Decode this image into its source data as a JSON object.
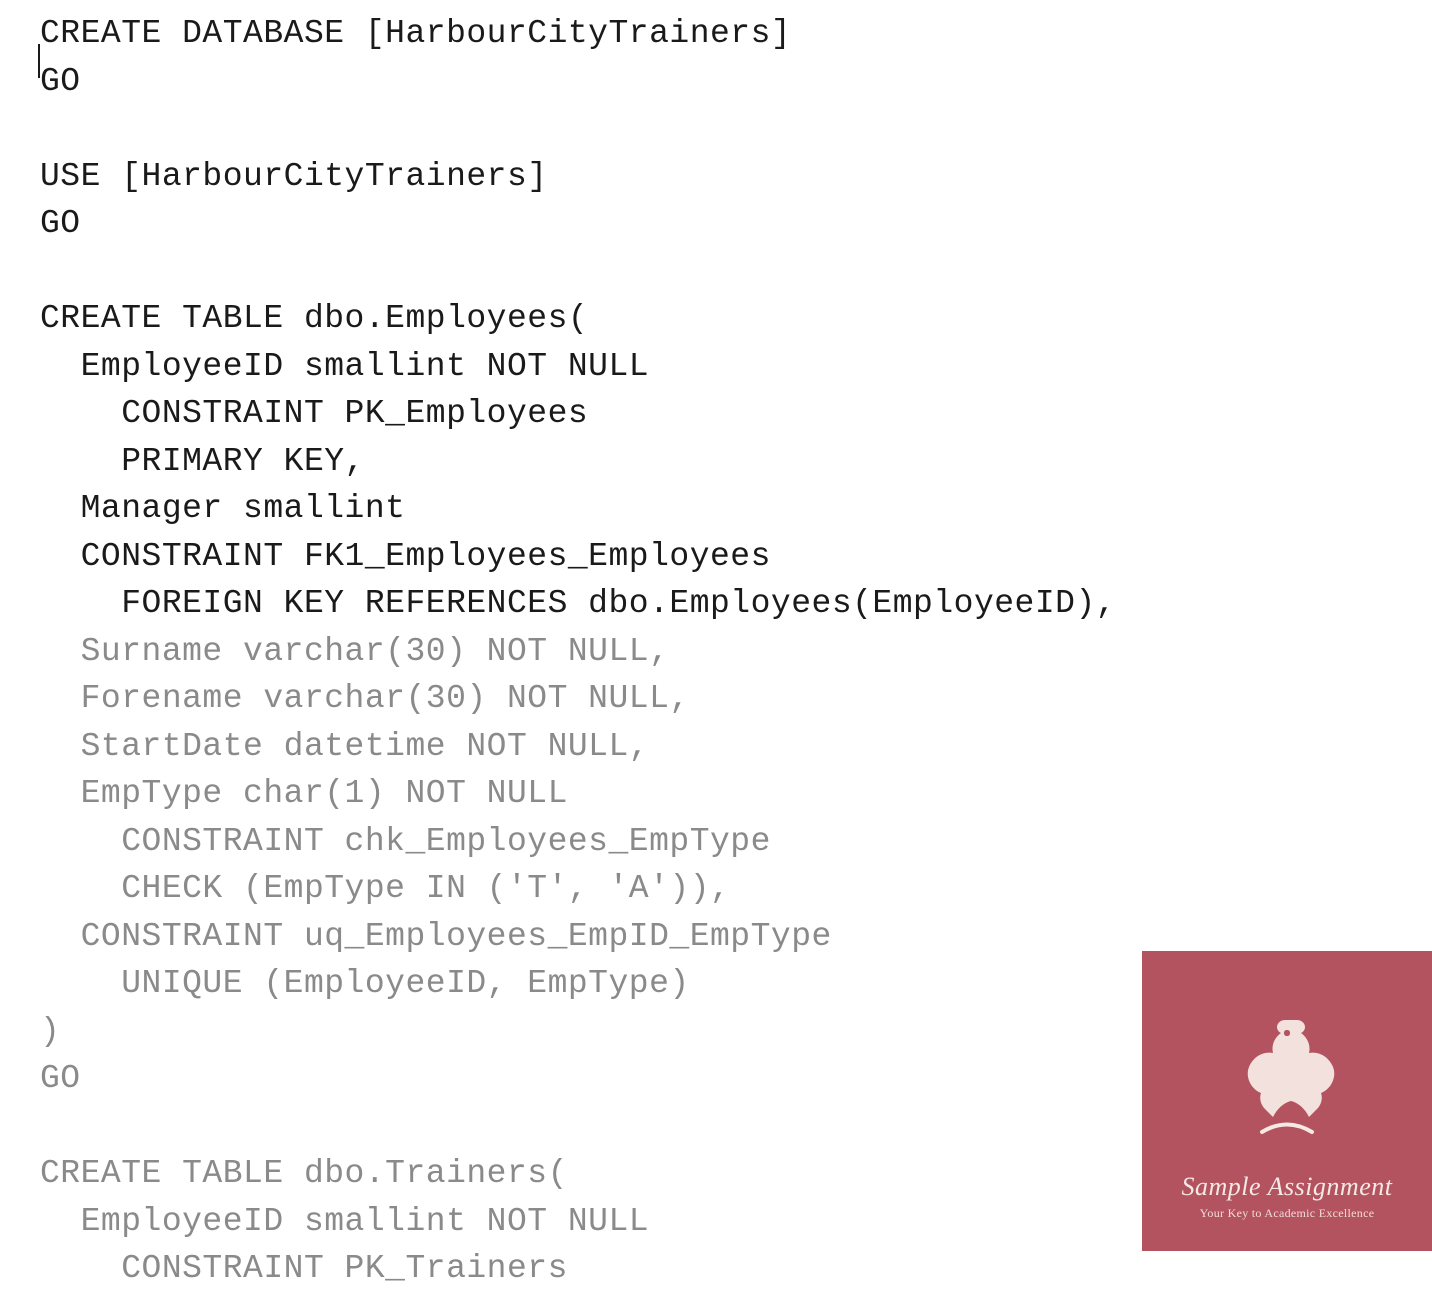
{
  "code": {
    "lines": [
      {
        "text": "CREATE DATABASE [HarbourCityTrainers]",
        "style": "dark",
        "cursor": true
      },
      {
        "text": "GO",
        "style": "dark"
      },
      {
        "text": "",
        "style": "dark"
      },
      {
        "text": "USE [HarbourCityTrainers]",
        "style": "dark"
      },
      {
        "text": "GO",
        "style": "dark"
      },
      {
        "text": "",
        "style": "dark"
      },
      {
        "text": "CREATE TABLE dbo.Employees(",
        "style": "dark"
      },
      {
        "text": "  EmployeeID smallint NOT NULL",
        "style": "dark"
      },
      {
        "text": "    CONSTRAINT PK_Employees",
        "style": "dark"
      },
      {
        "text": "    PRIMARY KEY,",
        "style": "dark"
      },
      {
        "text": "  Manager smallint",
        "style": "dark"
      },
      {
        "text": "  CONSTRAINT FK1_Employees_Employees",
        "style": "dark"
      },
      {
        "text": "    FOREIGN KEY REFERENCES dbo.Employees(EmployeeID),",
        "style": "dark"
      },
      {
        "text": "  Surname varchar(30) NOT NULL,",
        "style": "faded"
      },
      {
        "text": "  Forename varchar(30) NOT NULL,",
        "style": "faded"
      },
      {
        "text": "  StartDate datetime NOT NULL,",
        "style": "faded"
      },
      {
        "text": "  EmpType char(1) NOT NULL",
        "style": "faded"
      },
      {
        "text": "    CONSTRAINT chk_Employees_EmpType",
        "style": "faded"
      },
      {
        "text": "    CHECK (EmpType IN ('T', 'A')),",
        "style": "faded"
      },
      {
        "text": "  CONSTRAINT uq_Employees_EmpID_EmpType",
        "style": "faded"
      },
      {
        "text": "    UNIQUE (EmployeeID, EmpType)",
        "style": "faded"
      },
      {
        "text": ")",
        "style": "faded"
      },
      {
        "text": "GO",
        "style": "faded"
      },
      {
        "text": "",
        "style": "faded"
      },
      {
        "text": "CREATE TABLE dbo.Trainers(",
        "style": "faded"
      },
      {
        "text": "  EmployeeID smallint NOT NULL",
        "style": "faded"
      },
      {
        "text": "    CONSTRAINT PK_Trainers",
        "style": "faded"
      }
    ]
  },
  "watermark": {
    "title": "Sample Assignment",
    "subtitle": "Your Key to Academic Excellence"
  }
}
